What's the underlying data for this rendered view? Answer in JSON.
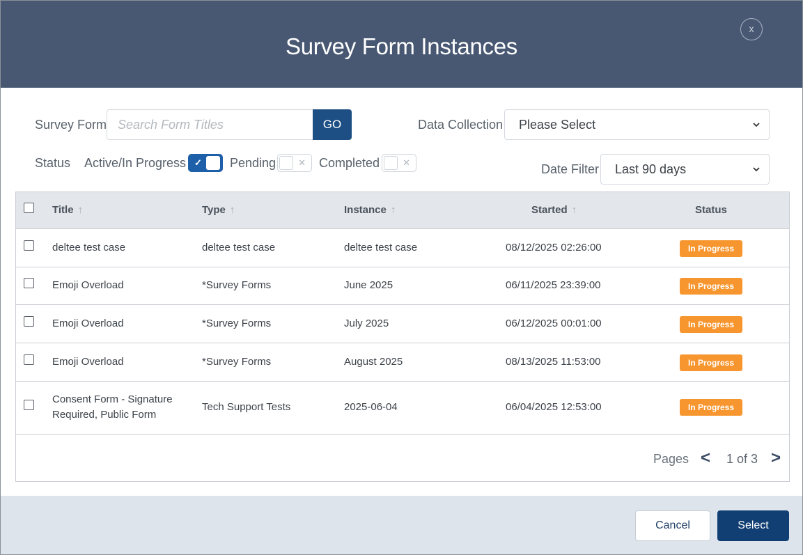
{
  "modal": {
    "title": "Survey Form Instances",
    "close_label": "x"
  },
  "filters": {
    "survey_form_label": "Survey Form",
    "search_placeholder": "Search Form Titles",
    "go_label": "GO",
    "data_collection_label": "Data Collection",
    "data_collection_value": "Please Select",
    "status_label": "Status",
    "toggles": [
      {
        "label": "Active/In Progress",
        "on": true
      },
      {
        "label": "Pending",
        "on": false
      },
      {
        "label": "Completed",
        "on": false
      }
    ],
    "date_filter_label": "Date Filter",
    "date_filter_value": "Last 90 days"
  },
  "table": {
    "columns": [
      "Title",
      "Type",
      "Instance",
      "Started",
      "Status"
    ],
    "sort_arrow": "↑",
    "rows": [
      {
        "title": "deltee test case",
        "type": "deltee test case",
        "instance": "deltee test case",
        "started": "08/12/2025 02:26:00",
        "status": "In Progress"
      },
      {
        "title": "Emoji Overload",
        "type": "*Survey Forms",
        "instance": "June 2025",
        "started": "06/11/2025 23:39:00",
        "status": "In Progress"
      },
      {
        "title": "Emoji Overload",
        "type": "*Survey Forms",
        "instance": "July 2025",
        "started": "06/12/2025 00:01:00",
        "status": "In Progress"
      },
      {
        "title": "Emoji Overload",
        "type": "*Survey Forms",
        "instance": "August 2025",
        "started": "08/13/2025 11:53:00",
        "status": "In Progress"
      },
      {
        "title": "Consent Form - Signature Required, Public Form",
        "type": "Tech Support Tests",
        "instance": "2025-06-04",
        "started": "06/04/2025 12:53:00",
        "status": "In Progress"
      }
    ]
  },
  "pagination": {
    "label": "Pages",
    "prev": "<",
    "next": ">",
    "current": "1 of 3"
  },
  "footer": {
    "cancel_label": "Cancel",
    "select_label": "Select"
  },
  "colors": {
    "header": "#485873",
    "primary": "#1d4f84",
    "badge": "#f7962f",
    "footer": "#dde4ec"
  }
}
